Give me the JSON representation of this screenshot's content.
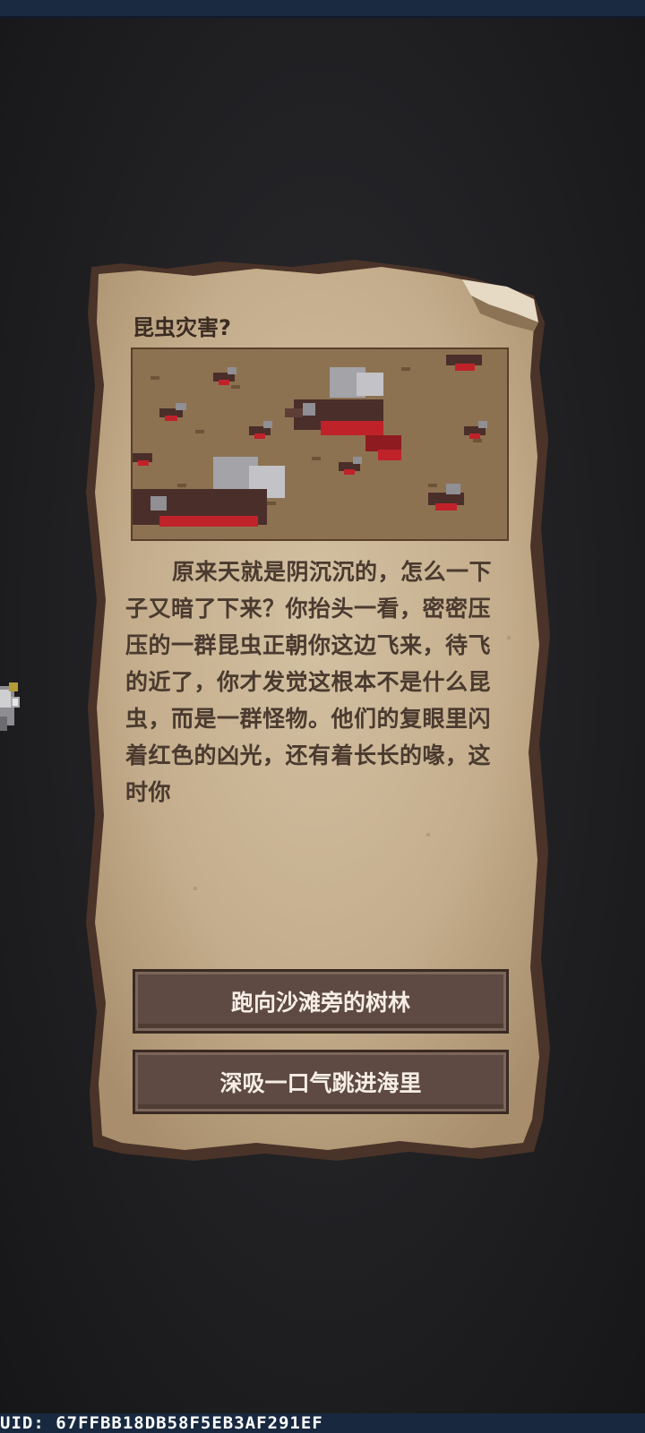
{
  "event": {
    "title": "昆虫灾害?",
    "image_icon": "insect-swarm-illustration",
    "story": "原来天就是阴沉沉的，怎么一下子又暗了下来？你抬头一看，密密压压的一群昆虫正朝你这边飞来，待飞的近了，你才发觉这根本不是什么昆虫，而是一群怪物。他们的复眼里闪着红色的凶光，还有着长长的喙，这时你"
  },
  "choices": [
    {
      "label": "跑向沙滩旁的树林"
    },
    {
      "label": "深吸一口气跳进海里"
    }
  ],
  "footer": {
    "uid_text": "UID: 67FFBB18DB58F5EB3AF291EF"
  },
  "colors": {
    "background": "#222225",
    "parchment": "#c9b596",
    "button": "#5e4a42",
    "text_dark": "#4a3a2f",
    "insect_red": "#c0222a"
  }
}
